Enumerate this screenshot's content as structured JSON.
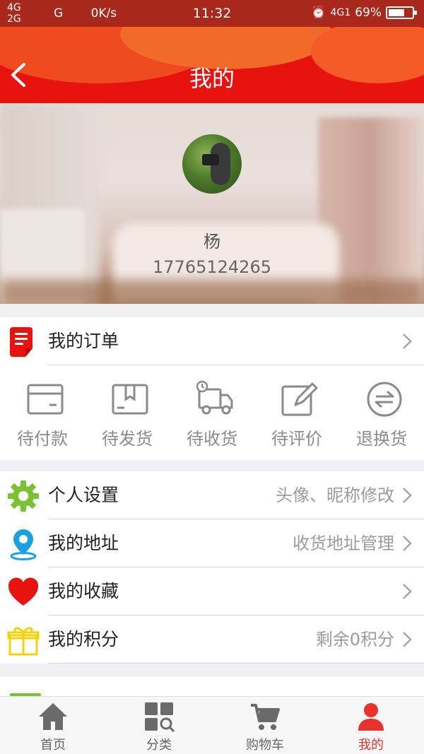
{
  "status_bar": {
    "network_top": "4G",
    "network_bottom": "2G",
    "network_extra": "G",
    "speed": "0K/s",
    "time": "11:32",
    "network_right": "4G1",
    "battery_text": "69%",
    "battery_level": 0.69
  },
  "nav": {
    "title": "我的"
  },
  "profile": {
    "name": "杨",
    "phone": "17765124265"
  },
  "orders": {
    "title": "我的订单",
    "statuses": [
      {
        "label": "待付款",
        "icon": "wallet-icon"
      },
      {
        "label": "待发货",
        "icon": "package-icon"
      },
      {
        "label": "待收货",
        "icon": "truck-icon"
      },
      {
        "label": "待评价",
        "icon": "edit-icon"
      },
      {
        "label": "退换货",
        "icon": "exchange-icon"
      }
    ]
  },
  "settings": [
    {
      "label": "个人设置",
      "hint": "头像、昵称修改",
      "icon": "gear-icon",
      "color": "#7ac232"
    },
    {
      "label": "我的地址",
      "hint": "收货地址管理",
      "icon": "location-pin-icon",
      "color": "#1ba1e2"
    },
    {
      "label": "我的收藏",
      "hint": "",
      "icon": "heart-icon",
      "color": "#e8120e"
    },
    {
      "label": "我的积分",
      "hint": "剩余0积分",
      "icon": "gift-icon",
      "color": "#f5d10a"
    }
  ],
  "tabs": [
    {
      "label": "首页",
      "icon": "home-icon"
    },
    {
      "label": "分类",
      "icon": "category-icon"
    },
    {
      "label": "购物车",
      "icon": "cart-icon"
    },
    {
      "label": "我的",
      "icon": "user-icon",
      "active": true
    }
  ],
  "colors": {
    "accent": "#e8120e",
    "active_tab": "#e8322e",
    "icon_gray": "#8a8a8a"
  }
}
